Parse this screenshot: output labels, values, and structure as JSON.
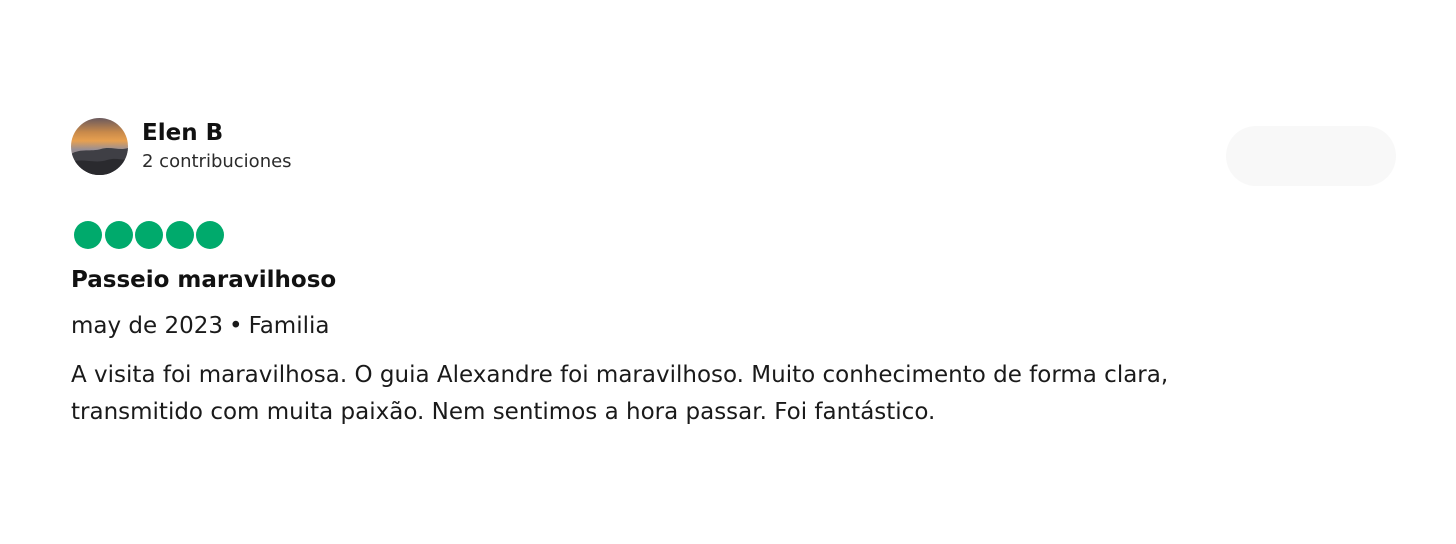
{
  "reviewer": {
    "name": "Elen B",
    "contributions": "2 contribuciones"
  },
  "rating": {
    "value": 5,
    "max": 5,
    "color": "#00aa6c"
  },
  "review": {
    "title": "Passeio maravilhoso",
    "date": "may de 2023",
    "separator": "•",
    "trip_type": "Familia",
    "body_line1": "A visita foi maravilhosa. O guia Alexandre foi maravilhoso. Muito conhecimento de forma clara,",
    "body_line2": "transmitido com muita paixão. Nem sentimos a hora passar. Foi fantástico."
  }
}
